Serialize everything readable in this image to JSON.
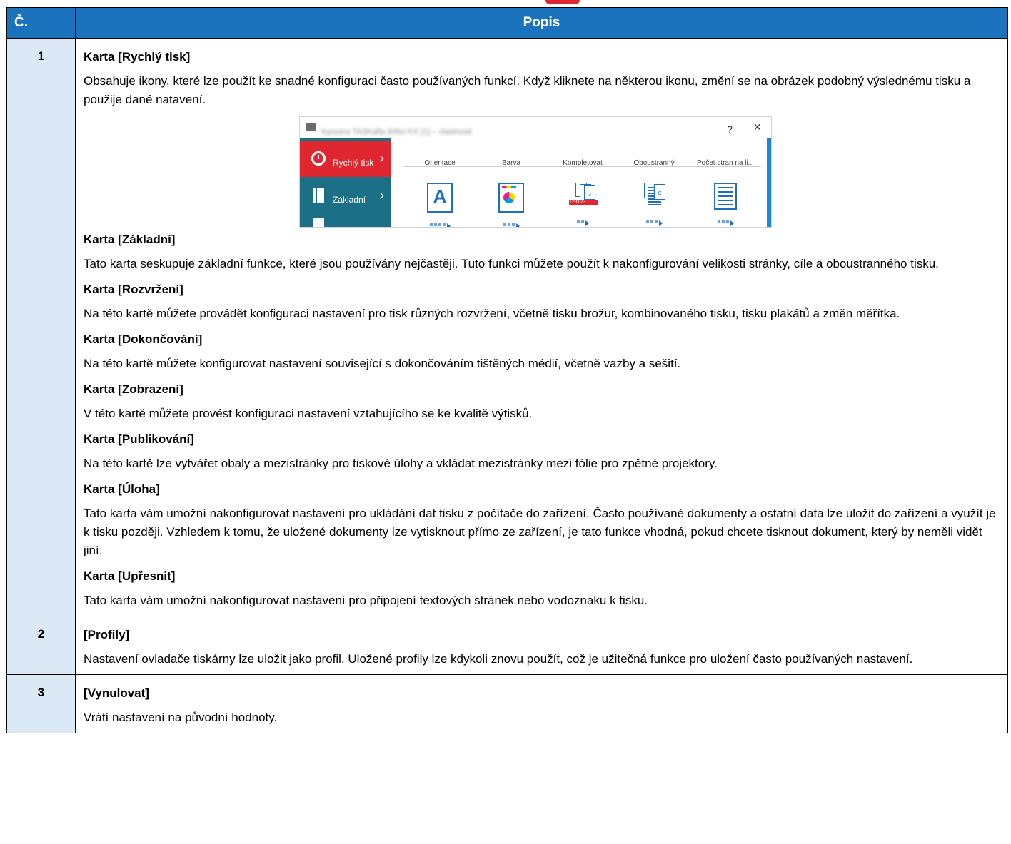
{
  "header": {
    "num": "Č.",
    "desc": "Popis"
  },
  "rows": [
    {
      "num": "1",
      "items": [
        {
          "title": "Karta [Rychlý tisk]",
          "text": "Obsahuje ikony, které lze použít ke snadné konfiguraci často používaných funkcí. Když kliknete na některou ikonu, změní se na obrázek podobný výslednému tisku a použije dané natavení."
        },
        {
          "title": "Karta [Základní]",
          "text": "Tato karta seskupuje základní funkce, které jsou používány nejčastěji. Tuto funkci můžete použít k nakonfigurování velikosti stránky, cíle a oboustranného tisku."
        },
        {
          "title": "Karta [Rozvržení]",
          "text": "Na této kartě můžete provádět konfiguraci nastavení pro tisk různých rozvržení, včetně tisku brožur, kombinovaného tisku, tisku plakátů a změn měřítka."
        },
        {
          "title": "Karta [Dokončování]",
          "text": "Na této kartě můžete konfigurovat nastavení související s dokončováním tištěných médií, včetně vazby a sešití."
        },
        {
          "title": "Karta [Zobrazení]",
          "text": "V této kartě můžete provést konfiguraci nastavení vztahujícího se ke kvalitě výtisků."
        },
        {
          "title": "Karta [Publikování]",
          "text": "Na této kartě lze vytvářet obaly a mezistránky pro tiskové úlohy a vkládat mezistránky mezi fólie pro zpětné projektory."
        },
        {
          "title": "Karta [Úloha]",
          "text": "Tato karta vám umožní nakonfigurovat nastavení pro ukládání dat tisku z počítače do zařízení. Často používané dokumenty a ostatní data lze uložit do zařízení a využít je k tisku později. Vzhledem k tomu, že uložené dokumenty lze vytisknout přímo ze zařízení, je tato funkce vhodná, pokud chcete tisknout dokument, který by neměli vidět jiní."
        },
        {
          "title": "Karta [Upřesnit]",
          "text": "Tato karta vám umožní nakonfigurovat nastavení pro připojení textových stránek nebo vodoznaku k tisku."
        }
      ]
    },
    {
      "num": "2",
      "items": [
        {
          "title": "[Profily]",
          "text": "Nastavení ovladače tiskárny lze uložit jako profil. Uložené profily lze kdykoli znovu použít, což je užitečná funkce pro uložení často používaných nastavení."
        }
      ]
    },
    {
      "num": "3",
      "items": [
        {
          "title": "[Vynulovat]",
          "text": "Vrátí nastavení na původní hodnoty."
        }
      ]
    }
  ],
  "screenshot": {
    "window_title": "Kyocera TASKalfa 306ci KX (1) – vlastnosti",
    "help_glyph": "?",
    "close_glyph": "×",
    "sidebar": [
      {
        "label": "Rychlý tisk",
        "icon": "stopwatch-icon",
        "selected": true
      },
      {
        "label": "Základní",
        "icon": "page-icon",
        "selected": false
      }
    ],
    "options": [
      {
        "label": "Orientace",
        "icon": "orientation-icon",
        "glyph": "A"
      },
      {
        "label": "Barva",
        "icon": "color-icon"
      },
      {
        "label": "Kompletovat",
        "icon": "collate-icon",
        "band": "123123"
      },
      {
        "label": "Oboustranný",
        "icon": "duplex-icon"
      },
      {
        "label": "Počet stran na li...",
        "icon": "pages-per-sheet-icon"
      }
    ]
  },
  "colors": {
    "header_bg": "#1b72bd",
    "num_cell_bg": "#dbe9f7",
    "accent_red": "#e0262e",
    "sidebar_teal": "#1b6f86"
  }
}
